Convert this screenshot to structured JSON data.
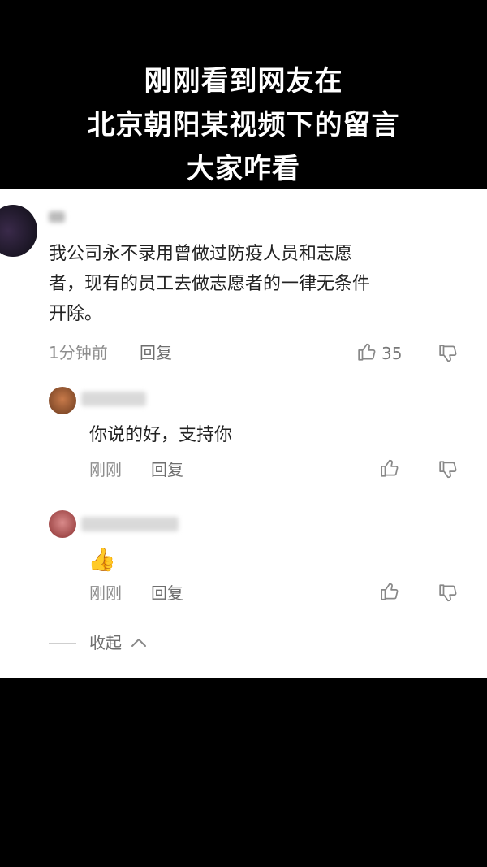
{
  "header": {
    "lines": [
      "刚刚看到网友在",
      "北京朝阳某视频下的留言",
      "大家咋看"
    ]
  },
  "comments": [
    {
      "text_lines": [
        "我公司永不录用曾做过防疫人员和志愿",
        "者，现有的员工去做志愿者的一律无条件",
        "开除。"
      ],
      "time": "1分钟前",
      "reply_label": "回复",
      "like_count": "35"
    }
  ],
  "replies": [
    {
      "text": "你说的好，支持你",
      "time": "刚刚",
      "reply_label": "回复"
    },
    {
      "emoji": "👍",
      "time": "刚刚",
      "reply_label": "回复"
    }
  ],
  "collapse_label": "收起",
  "colors": {
    "background": "#000000",
    "panel": "#ffffff",
    "text": "#222222",
    "meta": "#8e8e8e"
  }
}
